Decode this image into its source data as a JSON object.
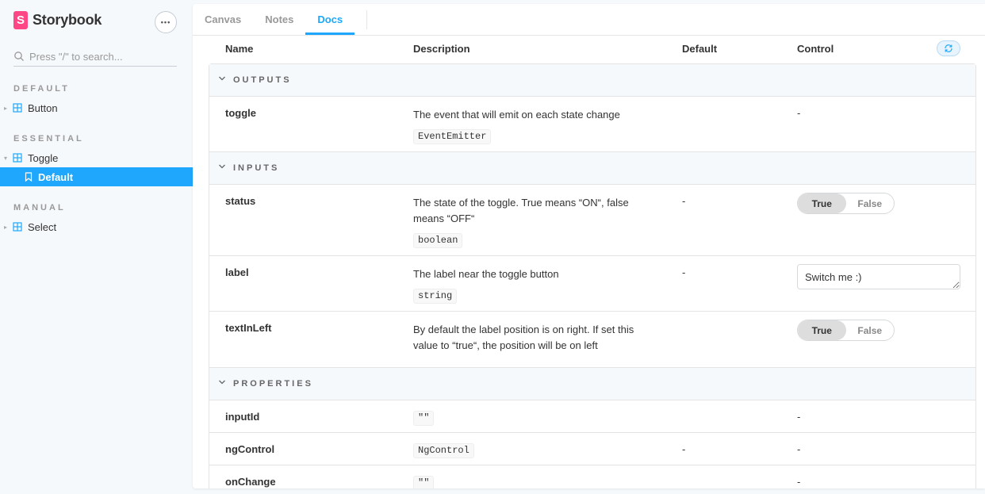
{
  "sidebar": {
    "brand": "Storybook",
    "logo_letter": "S",
    "menu_label": "•••",
    "search_placeholder": "Press \"/\" to search...",
    "sections": [
      {
        "title": "DEFAULT",
        "items": [
          {
            "label": "Button"
          }
        ]
      },
      {
        "title": "ESSENTIAL",
        "items": [
          {
            "label": "Toggle"
          },
          {
            "label": "Default"
          }
        ]
      },
      {
        "title": "MANUAL",
        "items": [
          {
            "label": "Select"
          }
        ]
      }
    ]
  },
  "tabs": [
    {
      "label": "Canvas",
      "active": false
    },
    {
      "label": "Notes",
      "active": false
    },
    {
      "label": "Docs",
      "active": true
    }
  ],
  "table": {
    "headers": {
      "name": "Name",
      "description": "Description",
      "default": "Default",
      "control": "Control"
    },
    "groups": {
      "outputs": "OUTPUTS",
      "inputs": "INPUTS",
      "properties": "PROPERTIES"
    },
    "rows": {
      "toggle": {
        "name": "toggle",
        "desc": "The event that will emit on each state change",
        "type": "EventEmitter",
        "default": "",
        "control": "-"
      },
      "status": {
        "name": "status",
        "desc": "The state of the toggle. True means “ON“, false means “OFF“",
        "type": "boolean",
        "default": "-",
        "control_true": "True",
        "control_false": "False",
        "value": true
      },
      "label": {
        "name": "label",
        "desc": "The label near the toggle button",
        "type": "string",
        "default": "-",
        "control_value": "Switch me :)"
      },
      "textInLeft": {
        "name": "textInLeft",
        "desc": "By default the label position is on right. If set this value to “true“, the position will be on left",
        "default": "",
        "control_true": "True",
        "control_false": "False",
        "value": true
      },
      "inputId": {
        "name": "inputId",
        "type": "\"\"",
        "default": "",
        "control": "-"
      },
      "ngControl": {
        "name": "ngControl",
        "type": "NgControl",
        "default": "-",
        "control": "-"
      },
      "onChange": {
        "name": "onChange",
        "type": "\"\"",
        "default": "",
        "control": "-"
      }
    }
  },
  "colors": {
    "accent": "#1ea7fd",
    "brand": "#ff4785"
  }
}
